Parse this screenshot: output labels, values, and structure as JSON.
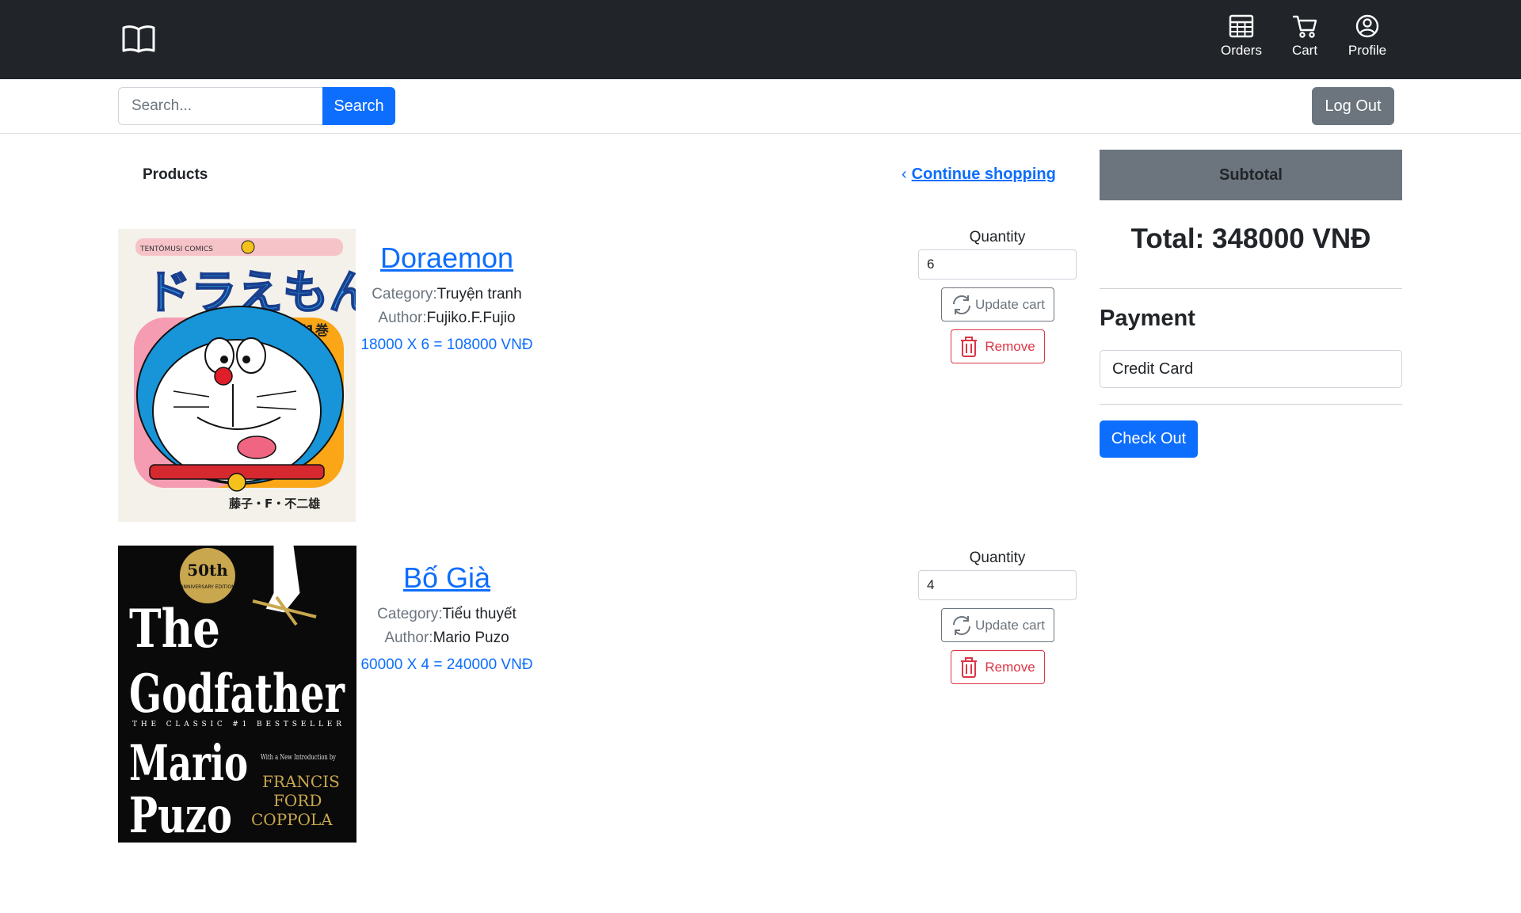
{
  "nav": {
    "orders_label": "Orders",
    "cart_label": "Cart",
    "profile_label": "Profile"
  },
  "search": {
    "placeholder": "Search...",
    "button_label": "Search"
  },
  "logout_label": "Log Out",
  "products_heading": "Products",
  "continue_shopping": "Continue shopping",
  "products": [
    {
      "title": "Doraemon",
      "category_label": "Category:",
      "category": "Truyện tranh",
      "author_label": "Author:",
      "author": "Fujiko.F.Fujio",
      "price_line": "18000 X 6 = 108000 VNĐ",
      "quantity_label": "Quantity",
      "quantity": "6",
      "update_label": "Update cart",
      "remove_label": "Remove",
      "cover": {
        "header": "TENTŌMUSI COMICS",
        "title": "ドラえもん",
        "volume": "第1巻",
        "author_jp": "藤子・F・不二雄"
      }
    },
    {
      "title": "Bố Già",
      "category_label": "Category:",
      "category": "Tiểu thuyết",
      "author_label": "Author:",
      "author": "Mario Puzo",
      "price_line": "60000 X 4 = 240000 VNĐ",
      "quantity_label": "Quantity",
      "quantity": "4",
      "update_label": "Update cart",
      "remove_label": "Remove",
      "cover": {
        "badge_top": "50th",
        "badge_bottom": "ANNIVERSARY EDITION",
        "title_line1": "The",
        "title_line2": "Godfather",
        "tagline": "THE CLASSIC #1 BESTSELLER",
        "author_line1": "Mario",
        "author_line2": "Puzo",
        "intro": "With a New Introduction by",
        "intro_name1": "FRANCIS",
        "intro_name2": "FORD",
        "intro_name3": "COPPOLA"
      }
    }
  ],
  "summary": {
    "subtotal_label": "Subtotal",
    "total": "Total: 348000 VNĐ",
    "payment_title": "Payment",
    "payment_method": "Credit Card",
    "checkout_label": "Check Out"
  },
  "colors": {
    "navbar": "#212529",
    "primary": "#0d6efd",
    "secondary": "#6c757d",
    "danger": "#dc3545"
  }
}
